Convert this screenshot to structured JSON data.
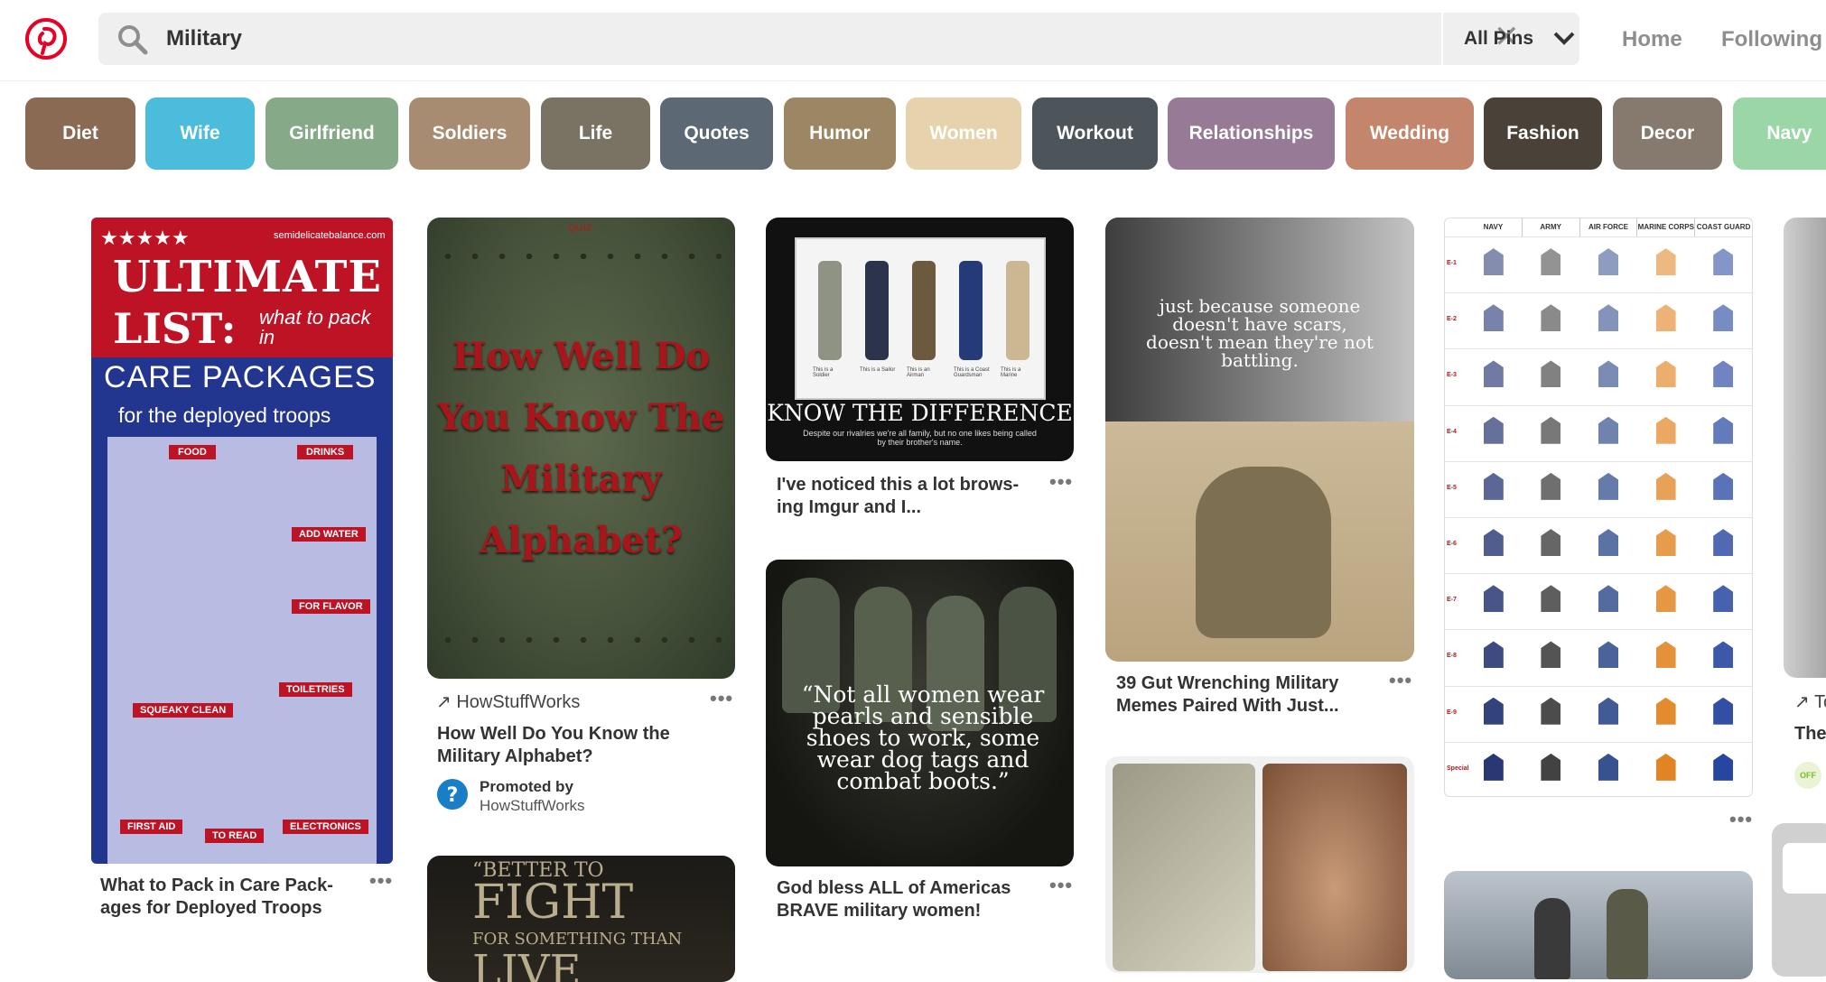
{
  "header": {
    "search": {
      "query": "Military",
      "filter_label": "All Pins"
    },
    "nav": {
      "home": "Home",
      "following": "Following"
    }
  },
  "chips": [
    {
      "label": "Diet",
      "color": "#8a6a52"
    },
    {
      "label": "Wife",
      "color": "#4cbcdc"
    },
    {
      "label": "Girlfriend",
      "color": "#86a987"
    },
    {
      "label": "Soldiers",
      "color": "#a88c72"
    },
    {
      "label": "Life",
      "color": "#7a7262"
    },
    {
      "label": "Quotes",
      "color": "#5c6873"
    },
    {
      "label": "Humor",
      "color": "#9c8664"
    },
    {
      "label": "Women",
      "color": "#e6d3ad"
    },
    {
      "label": "Workout",
      "color": "#4d545a"
    },
    {
      "label": "Relationships",
      "color": "#967a96"
    },
    {
      "label": "Wedding",
      "color": "#c4856d"
    },
    {
      "label": "Fashion",
      "color": "#4a4138"
    },
    {
      "label": "Decor",
      "color": "#857a6d"
    },
    {
      "label": "Navy",
      "color": "#9bd6a6"
    }
  ],
  "pins": {
    "care": {
      "site": "semidelicatebalance.com",
      "stars": "★★★★★",
      "headline1": "ULTIMATE",
      "headline2": "LIST:",
      "headline_side": "what to pack in",
      "headline3": "CARE PACKAGES",
      "headline4": "for the deployed troops",
      "sections": [
        "FOOD",
        "DRINKS",
        "ADD WATER",
        "FOR FLAVOR",
        "SQUEAKY CLEAN",
        "TOILETRIES",
        "FIRST AID",
        "TO READ",
        "ELECTRONICS"
      ],
      "title": "What to Pack in Care Pack-ages for Deployed Troops"
    },
    "alphabet": {
      "quiz": "QUIZ",
      "text": "How Well Do You Know The Military Alphabet?",
      "source": "HowStuffWorks",
      "title": "How Well Do You Know the Military Alphabet?",
      "promoted": "Promoted by",
      "promoter": "HowStuffWorks"
    },
    "difference": {
      "caption": "KNOW THE DIFFERENCE",
      "subcaption": "Despite our rivalries we're all family, but no one likes being called by their brother's name.",
      "labels": [
        "This is a Soldier",
        "This is a Sailor",
        "This is an Airman",
        "This is a Coast Guardsman",
        "This is a Marine"
      ],
      "title": "I've noticed this a lot brows-ing Imgur and I..."
    },
    "women": {
      "quote": "“Not all women wear pearls and sensible shoes to work, some wear dog tags and combat boots.”",
      "title": "God bless ALL of Americas BRAVE military women!"
    },
    "scars": {
      "quote": "just because someone doesn't have scars, doesn't mean they're not battling.",
      "title": "39 Gut Wrenching Military Memes Paired With Just..."
    },
    "fight": {
      "line1": "“BETTER TO",
      "line2": "FIGHT",
      "line3": "FOR SOMETHING THAN",
      "line4": "LIVE"
    },
    "ranks": {
      "columns": [
        "NAVY",
        "ARMY",
        "AIR FORCE",
        "MARINE CORPS",
        "COAST GUARD"
      ],
      "rows": [
        "E-1",
        "E-2",
        "E-3",
        "E-4",
        "E-5",
        "E-6",
        "E-7",
        "E-8",
        "E-9",
        "Special"
      ]
    },
    "edge": {
      "title": "The",
      "source_arrow": "↗ To"
    }
  }
}
